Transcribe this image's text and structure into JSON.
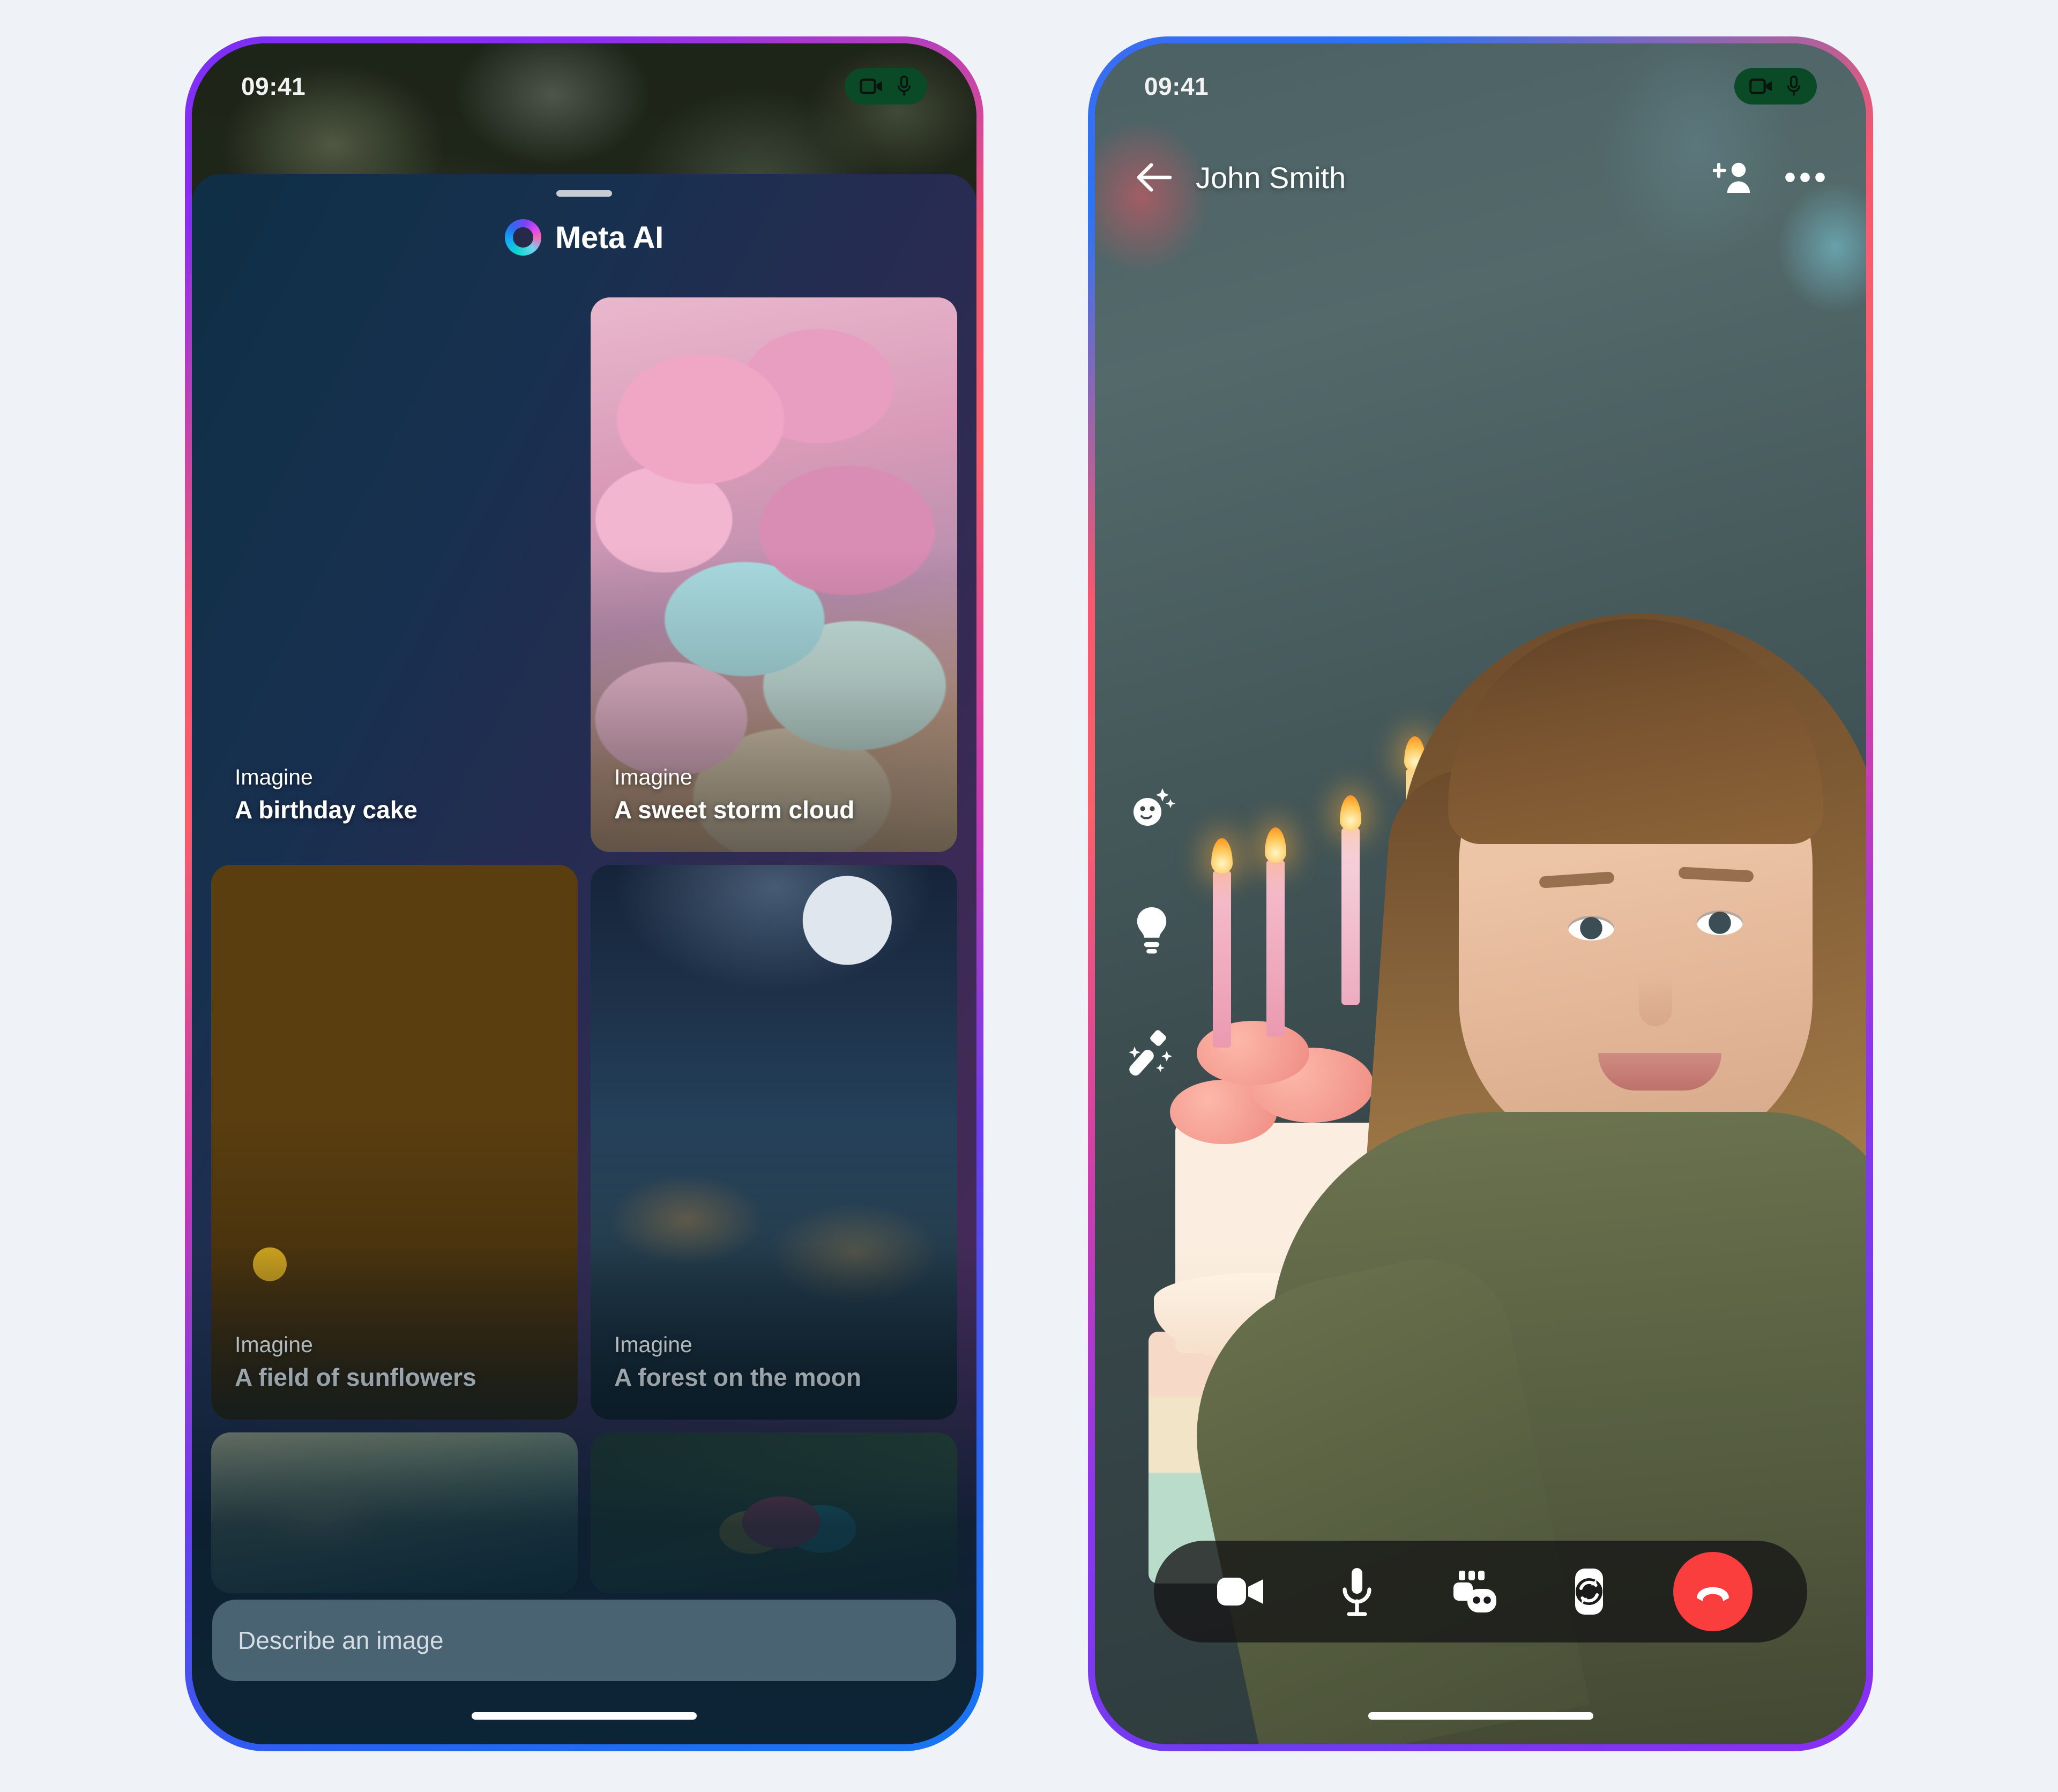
{
  "theme": {
    "page_bg": "#eff3f7",
    "frame_gradient_purple": "#7b2ff7",
    "frame_gradient_pink": "#f8576d",
    "frame_gradient_blue": "#1877f2",
    "end_call_red": "#fa3e3e",
    "recording_pill_green": "#0b4a26"
  },
  "left_phone": {
    "status_bar": {
      "time": "09:41",
      "indicators": [
        "video-recording-icon",
        "microphone-active-icon"
      ]
    },
    "sheet": {
      "grabber": "drag-handle",
      "logo_icon": "meta-ai-ring-icon",
      "title": "Meta AI"
    },
    "cards": [
      {
        "kicker": "Imagine",
        "prompt": "A birthday cake",
        "art": "img-cake"
      },
      {
        "kicker": "Imagine",
        "prompt": "A sweet storm cloud",
        "art": "img-cloud"
      },
      {
        "kicker": "Imagine",
        "prompt": "A field of sunflowers",
        "art": "img-sunflower"
      },
      {
        "kicker": "Imagine",
        "prompt": "A forest on the moon",
        "art": "img-moon"
      }
    ],
    "thumbnails": [
      {
        "art": "img-bunny",
        "label": "bunny-thumbnail"
      },
      {
        "art": "img-eggs",
        "label": "eggs-thumbnail"
      }
    ],
    "composer": {
      "placeholder": "Describe an image"
    },
    "home_indicator": "home-indicator"
  },
  "right_phone": {
    "status_bar": {
      "time": "09:41",
      "indicators": [
        "video-recording-icon",
        "microphone-active-icon"
      ]
    },
    "header": {
      "back_icon": "back-arrow-icon",
      "contact_name": "John Smith",
      "add_person_icon": "add-person-icon",
      "more_icon": "more-options-icon"
    },
    "effect_buttons": [
      {
        "icon": "avatar-effects-icon",
        "label": "Effects"
      },
      {
        "icon": "lighting-icon",
        "label": "Lighting"
      },
      {
        "icon": "touch-up-wand-icon",
        "label": "Touch up"
      }
    ],
    "call_controls": [
      {
        "icon": "video-camera-icon",
        "label": "Video"
      },
      {
        "icon": "microphone-icon",
        "label": "Mic"
      },
      {
        "icon": "effects-games-icon",
        "label": "Effects"
      },
      {
        "icon": "flip-camera-icon",
        "label": "Flip camera"
      },
      {
        "icon": "end-call-icon",
        "label": "End call"
      }
    ],
    "home_indicator": "home-indicator"
  }
}
